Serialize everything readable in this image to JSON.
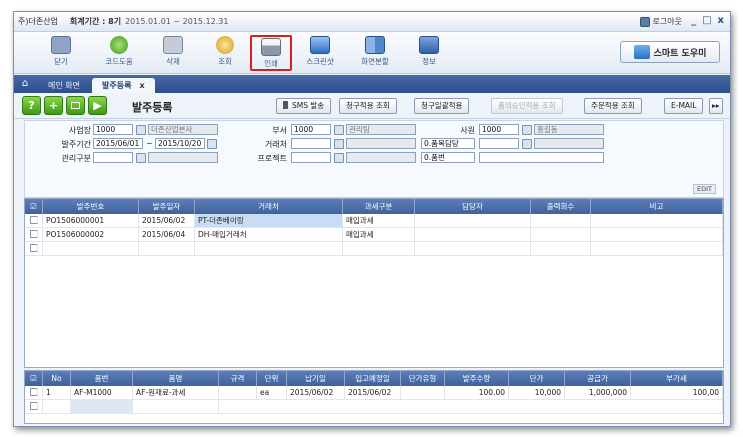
{
  "window": {
    "company": "주)더존산업",
    "period_label": "회계기간 : 8기",
    "period": "2015.01.01 ~ 2015.12.31",
    "logout": "로그아웃",
    "min": "_",
    "restore": "□",
    "close": "x"
  },
  "toolbar": {
    "items": [
      {
        "label": "닫기",
        "icon": "close-icon",
        "color": "#8da4c7"
      },
      {
        "label": "코드도움",
        "icon": "help-icon",
        "color": "#6fbf4a"
      },
      {
        "label": "삭제",
        "icon": "delete-icon",
        "color": "#9aa5b8"
      },
      {
        "label": "조회",
        "icon": "search-icon",
        "color": "#e1b33f"
      },
      {
        "label": "인쇄",
        "icon": "print-icon",
        "color": "#9ba4b3"
      },
      {
        "label": "스크린샷",
        "icon": "screenshot-icon",
        "color": "#5b8ed6"
      },
      {
        "label": "화면분할",
        "icon": "split-icon",
        "color": "#6a9fd8"
      },
      {
        "label": "정보",
        "icon": "info-icon",
        "color": "#4a78c4"
      }
    ],
    "smart_helper": "스마트 도우미"
  },
  "tabs": [
    {
      "label": "메인 화면"
    },
    {
      "label": "발주등록",
      "close": "x"
    }
  ],
  "actions": {
    "green_buttons": [
      "?",
      "+",
      "",
      "▶"
    ],
    "page_title": "발주등록",
    "buttons": [
      "SMS 발송",
      "청구적용 조회",
      "청구일괄적용",
      "품의승인적용 조회",
      "주문적용 조회",
      "E-MAIL"
    ],
    "more": "▸▸"
  },
  "form": {
    "biz_label": "사업장",
    "biz_code": "1000",
    "biz_name": "더존산업본사",
    "dept_label": "부서",
    "dept_code": "1000",
    "dept_name": "관리팀",
    "emp_label": "사원",
    "emp_code": "1000",
    "emp_name": "홍길동",
    "period_label": "발주기간",
    "date_from": "2015/06/01",
    "tilde": "~",
    "date_to": "2015/10/20",
    "vendor_label": "거래처",
    "item_mgr_sel": "0.품목담당",
    "mgmt_label": "관리구분",
    "project_label": "프로젝트",
    "item_sel": "0.품번",
    "edit": "EDIT"
  },
  "top_grid": {
    "headers": [
      "",
      "발주번호",
      "발주일자",
      "거래처",
      "과세구분",
      "담당자",
      "출력회수",
      "비고"
    ],
    "rows": [
      [
        "PO1506000001",
        "2015/06/02",
        "PT-더존베이링",
        "매입과세",
        "",
        "",
        ""
      ],
      [
        "PO1506000002",
        "2015/06/04",
        "DH-매입거래처",
        "매입과세",
        "",
        "",
        ""
      ],
      [
        "",
        "",
        "",
        "",
        "",
        "",
        ""
      ]
    ]
  },
  "bottom_grid": {
    "headers": [
      "",
      "No",
      "품번",
      "품명",
      "규격",
      "단위",
      "납기일",
      "입고예정일",
      "단가유형",
      "발주수량",
      "단가",
      "공급가",
      "부가세"
    ],
    "rows": [
      [
        "1",
        "AF-M1000",
        "AF-원재료-과세",
        "",
        "ea",
        "2015/06/02",
        "2015/06/02",
        "",
        "100.00",
        "10,000",
        "1,000,000",
        "100,00"
      ],
      [
        "",
        "",
        "",
        "",
        "",
        "",
        "",
        "",
        "",
        "",
        "",
        ""
      ]
    ]
  }
}
